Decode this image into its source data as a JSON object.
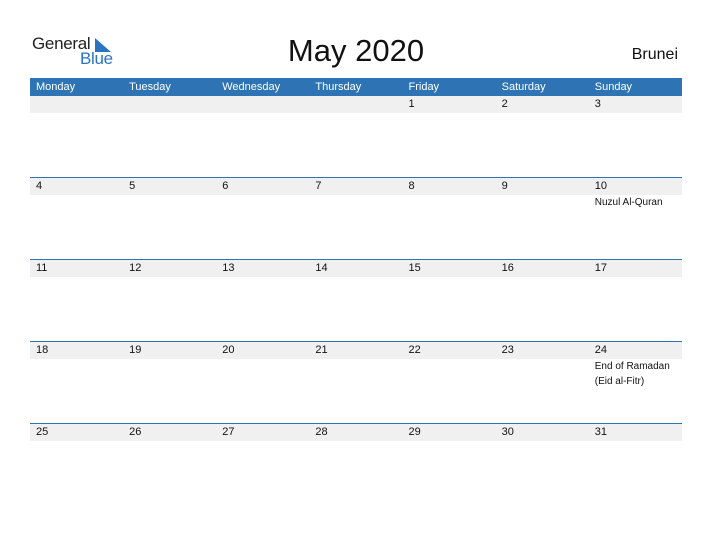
{
  "logo": {
    "general": "General",
    "blue": "Blue",
    "icon": "triangle-flag-icon"
  },
  "title": "May 2020",
  "country": "Brunei",
  "weekdays": [
    "Monday",
    "Tuesday",
    "Wednesday",
    "Thursday",
    "Friday",
    "Saturday",
    "Sunday"
  ],
  "weeks": [
    {
      "days": [
        "",
        "",
        "",
        "",
        "1",
        "2",
        "3"
      ],
      "events": [
        "",
        "",
        "",
        "",
        "",
        "",
        ""
      ]
    },
    {
      "days": [
        "4",
        "5",
        "6",
        "7",
        "8",
        "9",
        "10"
      ],
      "events": [
        "",
        "",
        "",
        "",
        "",
        "",
        "Nuzul Al-Quran"
      ]
    },
    {
      "days": [
        "11",
        "12",
        "13",
        "14",
        "15",
        "16",
        "17"
      ],
      "events": [
        "",
        "",
        "",
        "",
        "",
        "",
        ""
      ]
    },
    {
      "days": [
        "18",
        "19",
        "20",
        "21",
        "22",
        "23",
        "24"
      ],
      "events": [
        "",
        "",
        "",
        "",
        "",
        "",
        "End of Ramadan\n(Eid al-Fitr)"
      ]
    },
    {
      "days": [
        "25",
        "26",
        "27",
        "28",
        "29",
        "30",
        "31"
      ],
      "events": [
        "",
        "",
        "",
        "",
        "",
        "",
        ""
      ]
    }
  ],
  "colors": {
    "accent": "#2e74b5",
    "datebar": "#f0f0f0",
    "logo_blue": "#2a74c0"
  }
}
